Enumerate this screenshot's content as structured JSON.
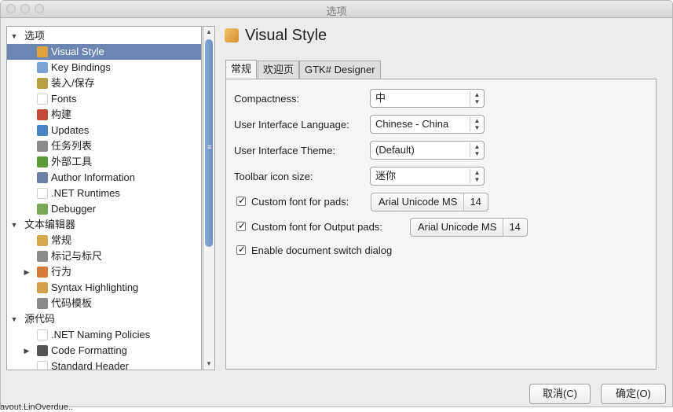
{
  "window": {
    "title": "选项"
  },
  "tree": {
    "items": [
      {
        "label": "选项",
        "level": 0,
        "expander": "down",
        "icon": "none"
      },
      {
        "label": "Visual Style",
        "level": 1,
        "selected": true,
        "icon": "palette-icon",
        "color": "#e0a33c"
      },
      {
        "label": "Key Bindings",
        "level": 1,
        "icon": "keyboard-icon",
        "color": "#7ea4d6"
      },
      {
        "label": "装入/保存",
        "level": 1,
        "icon": "disk-icon",
        "color": "#b9a044"
      },
      {
        "label": "Fonts",
        "level": 1,
        "icon": "blank-icon",
        "color": "#ffffff"
      },
      {
        "label": "构建",
        "level": 1,
        "icon": "build-icon",
        "color": "#c24b3a"
      },
      {
        "label": "Updates",
        "level": 1,
        "icon": "globe-icon",
        "color": "#4b83c7"
      },
      {
        "label": "任务列表",
        "level": 1,
        "icon": "list-icon",
        "color": "#8a8a8a"
      },
      {
        "label": "外部工具",
        "level": 1,
        "icon": "tools-icon",
        "color": "#5b9a3a"
      },
      {
        "label": "Author Information",
        "level": 1,
        "icon": "person-icon",
        "color": "#6d7fa6"
      },
      {
        "label": ".NET Runtimes",
        "level": 1,
        "icon": "blank-icon",
        "color": "#ffffff"
      },
      {
        "label": "Debugger",
        "level": 1,
        "icon": "bug-icon",
        "color": "#7aa85a"
      },
      {
        "label": "文本编辑器",
        "level": 0,
        "expander": "down",
        "icon": "none"
      },
      {
        "label": "常规",
        "level": 1,
        "icon": "edit-icon",
        "color": "#d6a94b"
      },
      {
        "label": "标记与标尺",
        "level": 1,
        "icon": "ruler-icon",
        "color": "#8a8a8a"
      },
      {
        "label": "行为",
        "level": 1,
        "expander": "right",
        "icon": "behavior-icon",
        "color": "#d67a3c"
      },
      {
        "label": "Syntax Highlighting",
        "level": 1,
        "icon": "highlight-icon",
        "color": "#d4a14a"
      },
      {
        "label": "代码模板",
        "level": 1,
        "icon": "template-icon",
        "color": "#8a8a8a"
      },
      {
        "label": "源代码",
        "level": 0,
        "expander": "down",
        "icon": "none"
      },
      {
        "label": ".NET Naming Policies",
        "level": 1,
        "icon": "blank-icon",
        "color": "#ffffff"
      },
      {
        "label": "Code Formatting",
        "level": 1,
        "expander": "right",
        "icon": "format-icon",
        "color": "#555555"
      },
      {
        "label": "Standard Header",
        "level": 1,
        "icon": "blank-icon",
        "color": "#ffffff"
      }
    ]
  },
  "panel": {
    "title": "Visual Style",
    "tabs": [
      {
        "label": "常规",
        "active": true
      },
      {
        "label": "欢迎页",
        "active": false
      },
      {
        "label": "GTK# Designer",
        "active": false
      }
    ],
    "compactness": {
      "label": "Compactness:",
      "value": "中"
    },
    "language": {
      "label": "User Interface Language:",
      "value": "Chinese - China"
    },
    "theme": {
      "label": "User Interface Theme:",
      "value": "(Default)"
    },
    "toolbar_icon_size": {
      "label": "Toolbar icon size:",
      "value": "迷你"
    },
    "custom_font_pads": {
      "label": "Custom font for pads:",
      "checked": true,
      "font": "Arial Unicode MS",
      "size": "14"
    },
    "custom_font_output": {
      "label": "Custom font for Output pads:",
      "checked": true,
      "font": "Arial Unicode MS",
      "size": "14"
    },
    "doc_switch": {
      "label": "Enable document switch dialog",
      "checked": true
    }
  },
  "buttons": {
    "cancel": "取消(C)",
    "ok": "确定(O)"
  },
  "background_text": "avout.LinOverdue..",
  "colors": {
    "selection": "#6b86b3",
    "panel_bg": "#f6f6f6",
    "scroll_thumb": "#7a9acc"
  }
}
